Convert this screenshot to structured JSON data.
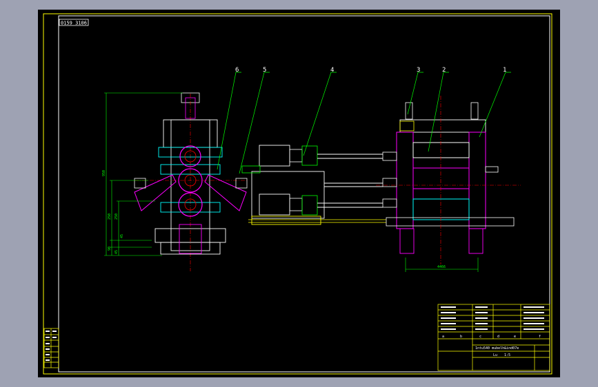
{
  "drawing_code": "0159 3106",
  "balloons": [
    "1",
    "2",
    "3",
    "4",
    "5",
    "6"
  ],
  "side_view": {
    "dims": [
      "950",
      "250",
      "250",
      "45",
      "90",
      "45"
    ]
  },
  "front_view": {
    "bottom_dim": "4466"
  },
  "title_block": {
    "drawing_title": "1ntu540 mubelh&ind07e",
    "scale": "1:5",
    "scale_label": "Lu",
    "letters": [
      "a",
      "b",
      "c",
      "d",
      "e",
      "f"
    ]
  },
  "colors": {
    "paper": "#000000",
    "frame": "#ffffff",
    "title_block": "#ffff00",
    "leader": "#00ff00",
    "dimension": "#00ff00",
    "roll": "#ff00ff",
    "housing": "#ffffff",
    "bearing": "#00ffff",
    "hydraulic": "#ffff00",
    "centerline": "#ff0000"
  }
}
